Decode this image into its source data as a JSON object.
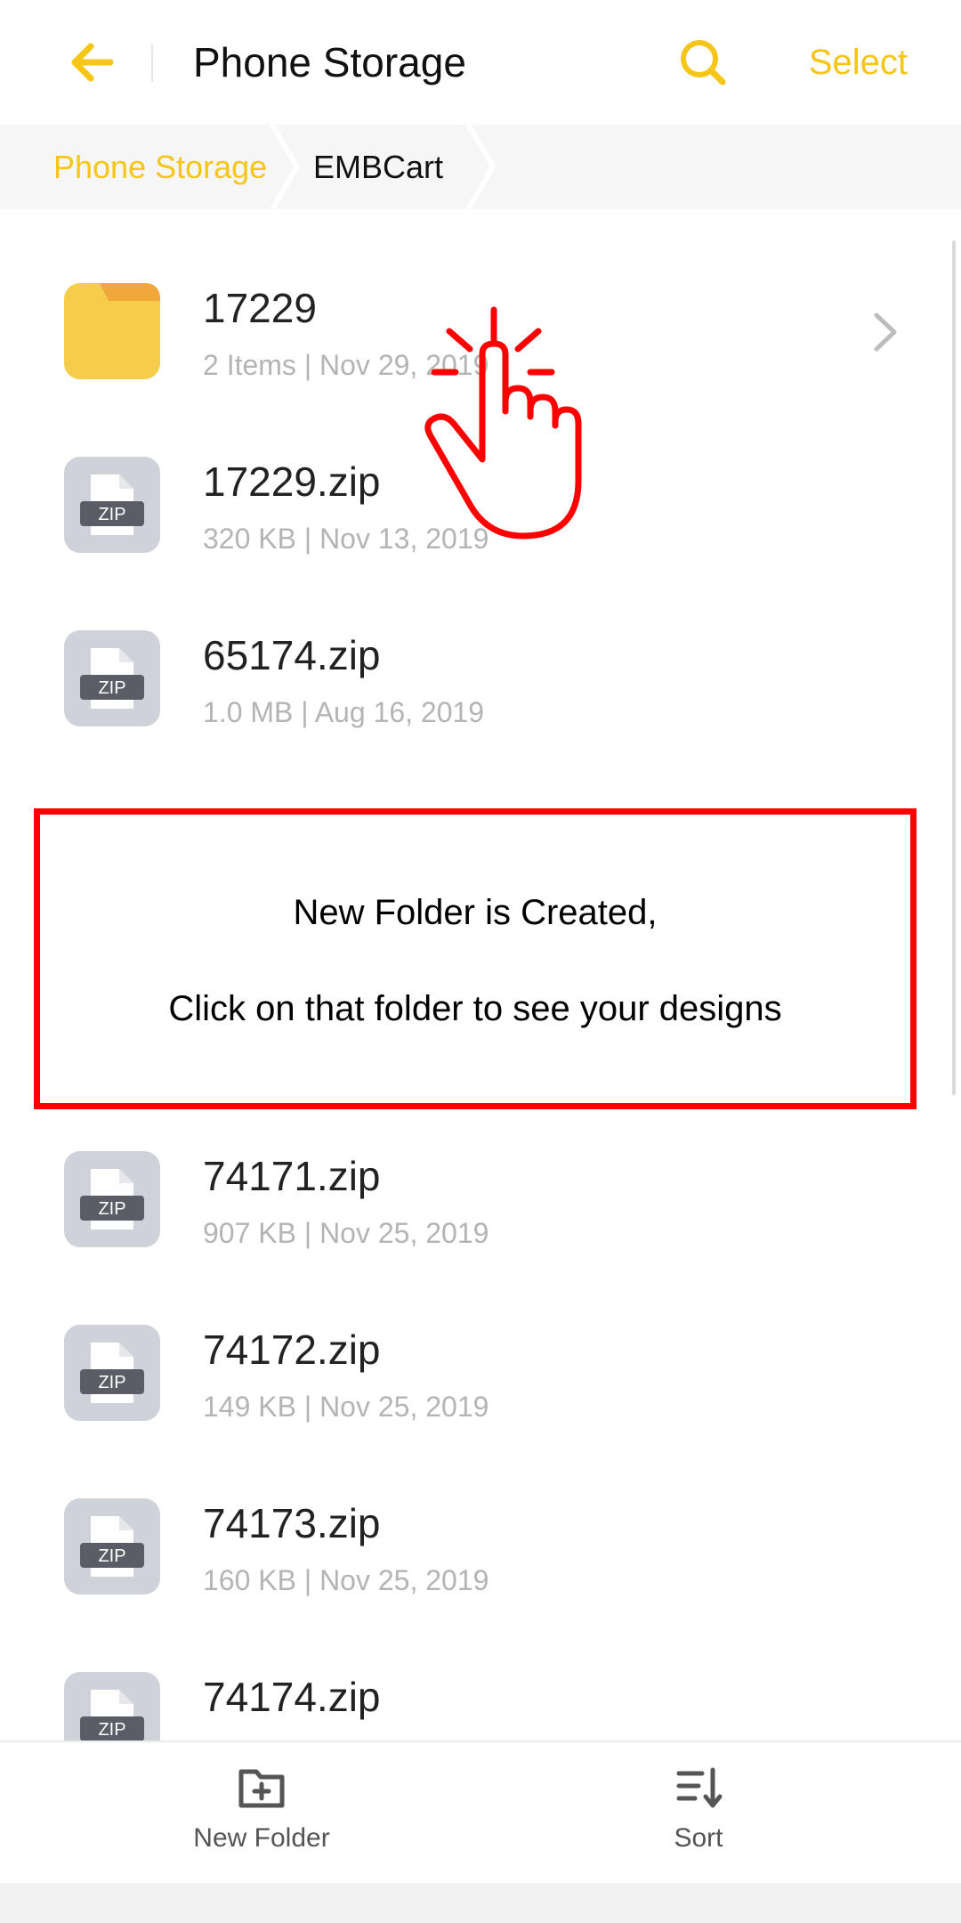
{
  "header": {
    "title": "Phone Storage",
    "select_label": "Select",
    "back_icon": "arrow-left-icon",
    "search_icon": "search-icon",
    "accent_color": "#f5c518"
  },
  "breadcrumb": {
    "items": [
      "Phone Storage",
      "EMBCart"
    ]
  },
  "files": [
    {
      "name": "17229",
      "meta": "2 Items | Nov 29, 2019",
      "type": "folder"
    },
    {
      "name": "17229.zip",
      "meta": "320 KB | Nov 13, 2019",
      "type": "zip"
    },
    {
      "name": "65174.zip",
      "meta": "1.0 MB | Aug 16, 2019",
      "type": "zip"
    },
    {
      "name": "74171.zip",
      "meta": "907 KB | Nov 25, 2019",
      "type": "zip"
    },
    {
      "name": "74172.zip",
      "meta": "149 KB | Nov 25, 2019",
      "type": "zip"
    },
    {
      "name": "74173.zip",
      "meta": "160 KB | Nov 25, 2019",
      "type": "zip"
    },
    {
      "name": "74174.zip",
      "meta": "",
      "type": "zip"
    }
  ],
  "zip_badge": "ZIP",
  "annotation": {
    "line1": "New Folder is Created,",
    "line2": "Click on that folder to see your designs",
    "color": "#ff0000"
  },
  "bottom_bar": {
    "new_folder_label": "New Folder",
    "sort_label": "Sort",
    "new_folder_icon": "folder-plus-icon",
    "sort_icon": "sort-icon"
  }
}
